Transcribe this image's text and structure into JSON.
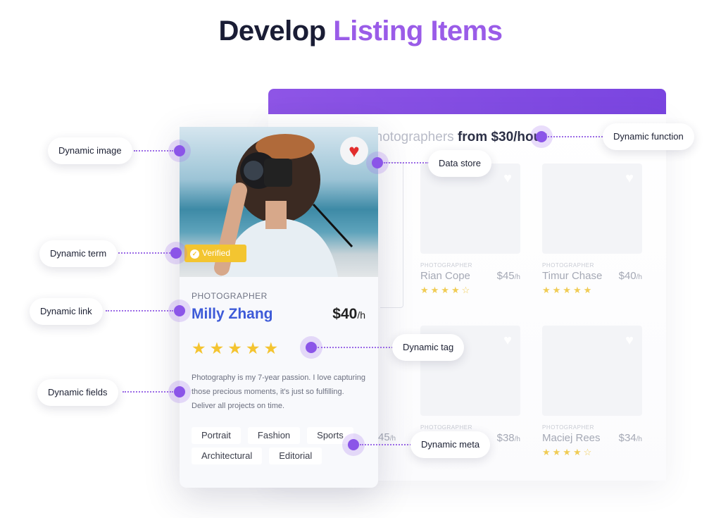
{
  "title": {
    "part1": "Develop",
    "part2": "Listing Items"
  },
  "colors": {
    "accent": "#9a5ce8",
    "name": "#3d5ad8",
    "star": "#f4c430",
    "verified": "#f3c530",
    "heart": "#e22d2d"
  },
  "listing": {
    "heading_light": "Photographers",
    "heading_bold": "from $30/hour",
    "cards": [
      {
        "role": "PHOTOGRAPHER",
        "name": "Rian Cope",
        "price": "$45",
        "unit": "/h",
        "stars": "★★★★☆",
        "rating": 4
      },
      {
        "role": "PHOTOGRAPHER",
        "name": "Timur Chase",
        "price": "$40",
        "unit": "/h",
        "stars": "★★★★★",
        "rating": 5
      },
      {
        "role": "PHOTOGRAPHER",
        "name": "",
        "price": "$38",
        "unit": "/h",
        "stars": "",
        "rating": null
      },
      {
        "role": "PHOTOGRAPHER",
        "name": "Maciej Rees",
        "price": "$34",
        "unit": "/h",
        "stars": "★★★★☆",
        "rating": 4
      }
    ],
    "partial_price": "45",
    "partial_unit": "/h"
  },
  "featured": {
    "badge": "Verified",
    "role": "PHOTOGRAPHER",
    "name": "Milly Zhang",
    "price": "$40",
    "unit": "/h",
    "stars": "★★★★★",
    "rating": 5,
    "description": "Photography is my 7-year passion. I love capturing those precious moments, it's just so fulfilling. Deliver all projects on time.",
    "tags": [
      "Portrait",
      "Fashion",
      "Sports",
      "Architectural",
      "Editorial"
    ],
    "heart_icon": "heart-icon",
    "check_icon": "check-circle-icon"
  },
  "labels": {
    "image": "Dynamic image",
    "term": "Dynamic term",
    "link": "Dynamic link",
    "fields": "Dynamic fields",
    "function": "Dynamic function",
    "store": "Data store",
    "tag": "Dynamic tag",
    "meta": "Dynamic meta"
  }
}
